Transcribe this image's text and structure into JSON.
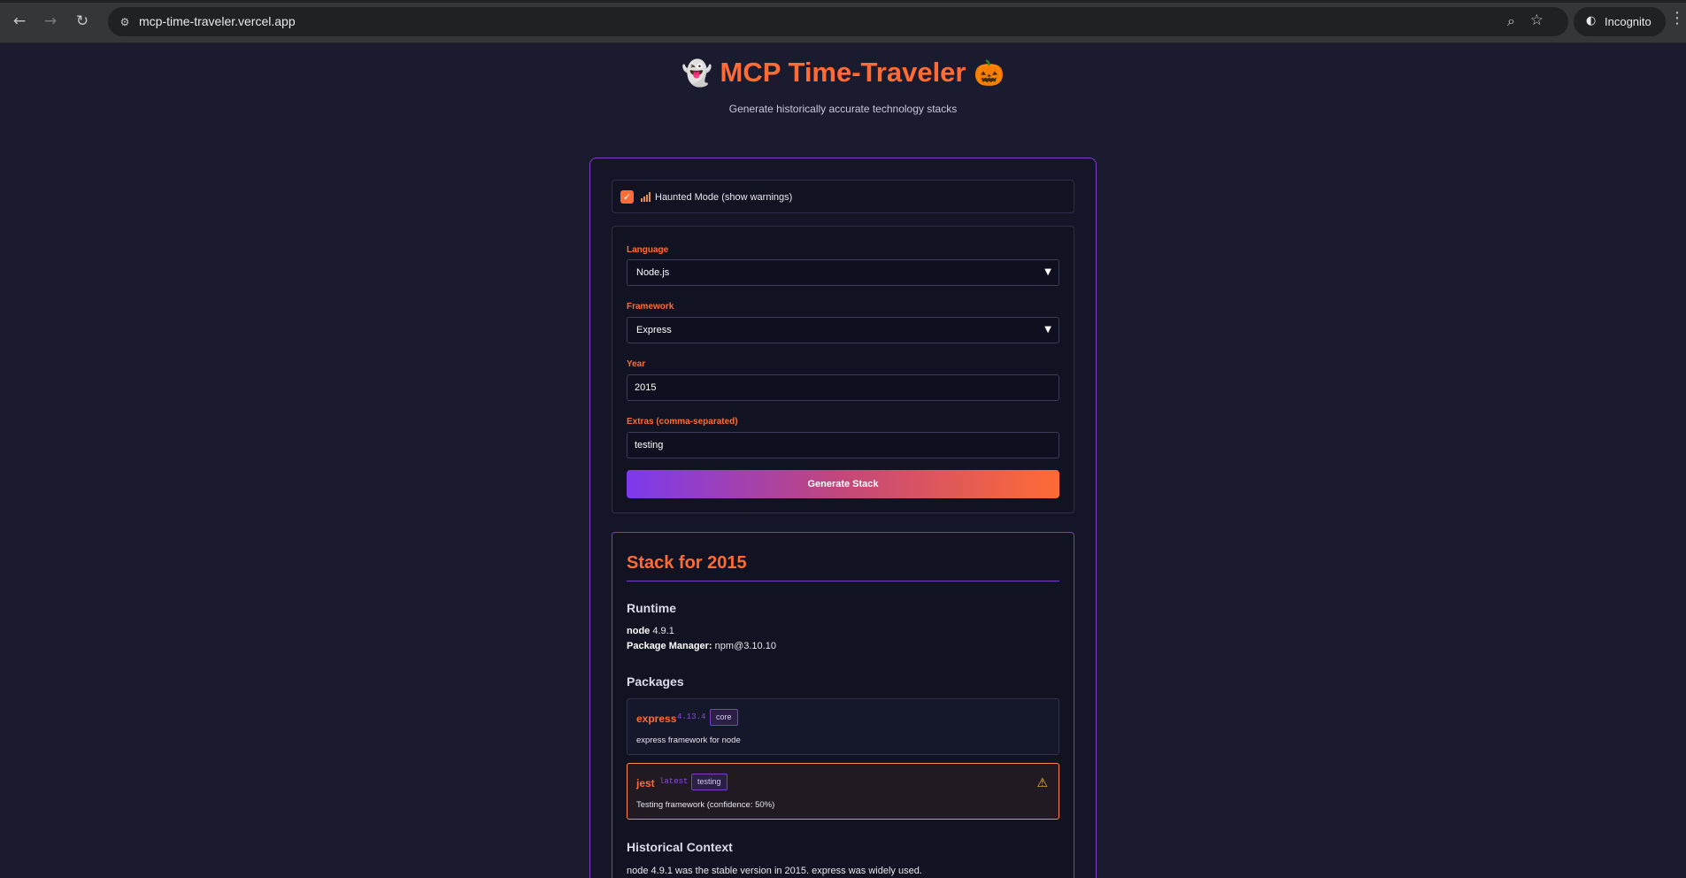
{
  "browser": {
    "url": "mcp-time-traveler.vercel.app",
    "profile_label": "Incognito"
  },
  "header": {
    "title": "MCP Time-Traveler",
    "emoji_left": "👻",
    "emoji_right": "🎃",
    "subtitle": "Generate historically accurate technology stacks"
  },
  "settings": {
    "haunted_checked": true,
    "haunted_label": "Haunted Mode (show warnings)"
  },
  "form": {
    "language_label": "Language",
    "language_value": "Node.js",
    "framework_label": "Framework",
    "framework_value": "Express",
    "year_label": "Year",
    "year_value": "2015",
    "extras_label": "Extras (comma-separated)",
    "extras_value": "testing",
    "generate_label": "Generate Stack"
  },
  "result": {
    "title": "Stack for 2015",
    "runtime_heading": "Runtime",
    "runtime_name": "node",
    "runtime_version": "4.9.1",
    "package_manager_label": "Package Manager:",
    "package_manager_value": "npm@3.10.10",
    "packages_heading": "Packages",
    "packages": [
      {
        "name": "express",
        "version": "4.13.4",
        "tag": "core",
        "description": "express framework for node",
        "warning": false
      },
      {
        "name": "jest",
        "version": "latest",
        "tag": "testing",
        "description": "Testing framework (confidence: 50%)",
        "warning": true
      }
    ],
    "context_heading": "Historical Context",
    "context_text": "node 4.9.1 was the stable version in 2015. express was widely used."
  },
  "colors": {
    "accent_orange": "#ff6b35",
    "accent_purple": "#7b3fc4",
    "warning_yellow": "#f5b833",
    "page_background": "#1a1b2e"
  }
}
